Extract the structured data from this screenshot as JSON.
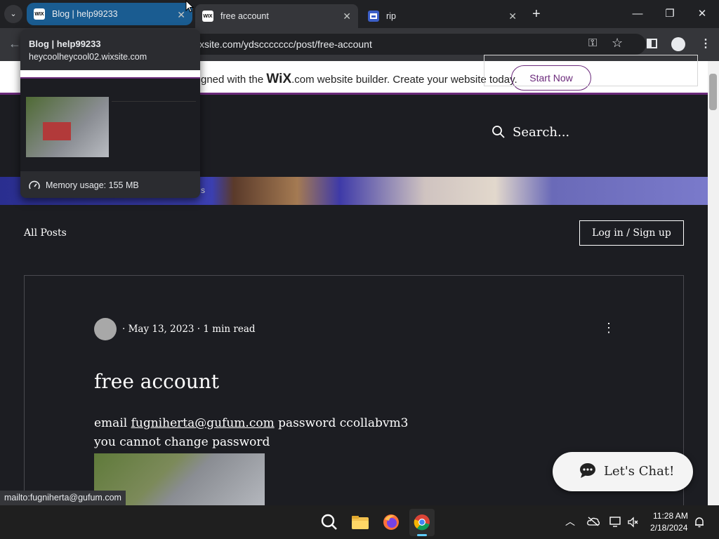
{
  "tabs": [
    {
      "title": "Blog | help99233",
      "favicon": "WIX"
    },
    {
      "title": "free account",
      "favicon": "WIX"
    },
    {
      "title": "rip",
      "favicon": "app-icon"
    }
  ],
  "address_bar": {
    "url": "xsite.com/ydsccccccc/post/free-account"
  },
  "hover_card": {
    "title": "Blog | help99233",
    "url": "heycoolheycool02.wixsite.com",
    "memory": "Memory usage: 155 MB"
  },
  "wix_banner": {
    "text_prefix": "gned with the",
    "logo": "WiX",
    "text_suffix": ".com website builder. Create your website today.",
    "button": "Start Now"
  },
  "site": {
    "search_placeholder": "Search...",
    "all_posts": "All Posts",
    "login": "Log in / Sign up",
    "nav_fragment": "s"
  },
  "post": {
    "date": "May 13, 2023",
    "read_time": "1 min read",
    "title": "free account",
    "line1_prefix": "email",
    "email": "fugniherta@gufum.com",
    "line1_suffix": "password ccollabvm3",
    "line2": "you cannot change password"
  },
  "chat": {
    "label": "Let's Chat!"
  },
  "status_bar": "mailto:fugniherta@gufum.com",
  "taskbar": {
    "time": "11:28 AM",
    "date": "2/18/2024"
  },
  "colors": {
    "wix_purple": "#6b2a7b",
    "active_tab": "#1a5c91",
    "page_bg": "#1c1d22"
  }
}
